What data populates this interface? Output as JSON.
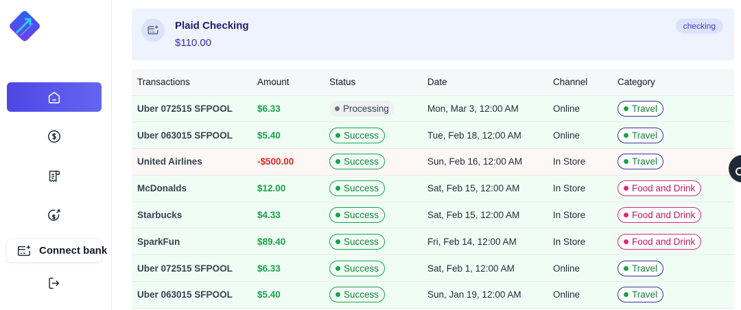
{
  "sidebar": {
    "logo_icon": "brand-logo-icon",
    "items": [
      {
        "icon": "home-icon",
        "active": true
      },
      {
        "icon": "dollar-circle-icon",
        "active": false
      },
      {
        "icon": "receipt-icon",
        "active": false
      },
      {
        "icon": "money-send-icon",
        "active": false
      }
    ],
    "connect_bank_label": "Connect bank",
    "logout_icon": "logout-icon"
  },
  "account": {
    "name": "Plaid Checking",
    "balance": "$110.00",
    "type_badge": "checking"
  },
  "table": {
    "columns": [
      "Transactions",
      "Amount",
      "Status",
      "Date",
      "Channel",
      "Category"
    ],
    "rows": [
      {
        "name": "Uber 072515 SFPOOL",
        "amount": "$6.33",
        "status": "Processing",
        "date": "Mon, Mar 3, 12:00 AM",
        "channel": "Online",
        "category": "Travel"
      },
      {
        "name": "Uber 063015 SFPOOL",
        "amount": "$5.40",
        "status": "Success",
        "date": "Tue, Feb 18, 12:00 AM",
        "channel": "Online",
        "category": "Travel"
      },
      {
        "name": "United Airlines",
        "amount": "-$500.00",
        "status": "Success",
        "date": "Sun, Feb 16, 12:00 AM",
        "channel": "In Store",
        "category": "Travel"
      },
      {
        "name": "McDonalds",
        "amount": "$12.00",
        "status": "Success",
        "date": "Sat, Feb 15, 12:00 AM",
        "channel": "In Store",
        "category": "Food and Drink"
      },
      {
        "name": "Starbucks",
        "amount": "$4.33",
        "status": "Success",
        "date": "Sat, Feb 15, 12:00 AM",
        "channel": "In Store",
        "category": "Food and Drink"
      },
      {
        "name": "SparkFun",
        "amount": "$89.40",
        "status": "Success",
        "date": "Fri, Feb 14, 12:00 AM",
        "channel": "In Store",
        "category": "Food and Drink"
      },
      {
        "name": "Uber 072515 SFPOOL",
        "amount": "$6.33",
        "status": "Success",
        "date": "Sat, Feb 1, 12:00 AM",
        "channel": "Online",
        "category": "Travel"
      },
      {
        "name": "Uber 063015 SFPOOL",
        "amount": "$5.40",
        "status": "Success",
        "date": "Sun, Jan 19, 12:00 AM",
        "channel": "Online",
        "category": "Travel"
      }
    ]
  },
  "colors": {
    "accent": "#4f46e5",
    "positive": "#16a34a",
    "negative": "#dc2626",
    "food": "#db2777"
  }
}
